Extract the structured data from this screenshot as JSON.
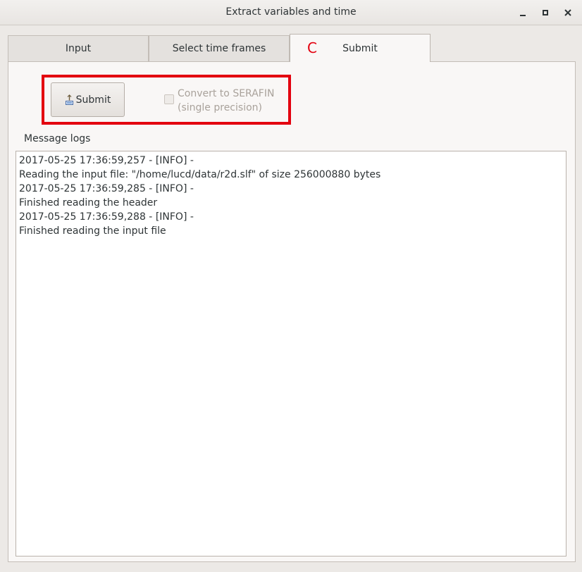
{
  "window": {
    "title": "Extract variables and time"
  },
  "tabs": [
    {
      "label": "Input"
    },
    {
      "label": "Select time frames"
    },
    {
      "label": "Submit",
      "marker": "C"
    }
  ],
  "submit_panel": {
    "submit_label": "Submit",
    "checkbox_label_line1": "Convert to SERAFIN",
    "checkbox_label_line2": "(single precision)",
    "checkbox_checked": false,
    "checkbox_enabled": false
  },
  "logs": {
    "label": "Message logs",
    "lines": [
      "2017-05-25 17:36:59,257 - [INFO] -",
      "Reading the input file: \"/home/lucd/data/r2d.slf\" of size 256000880 bytes",
      "2017-05-25 17:36:59,285 - [INFO] -",
      "Finished reading the header",
      "2017-05-25 17:36:59,288 - [INFO] -",
      "Finished reading the input file"
    ]
  },
  "colors": {
    "highlight": "#e3000f",
    "window_bg": "#ece9e6"
  },
  "icons": {
    "minimize": "minimize-icon",
    "maximize": "maximize-icon",
    "close": "close-icon",
    "submit": "upload-icon"
  }
}
